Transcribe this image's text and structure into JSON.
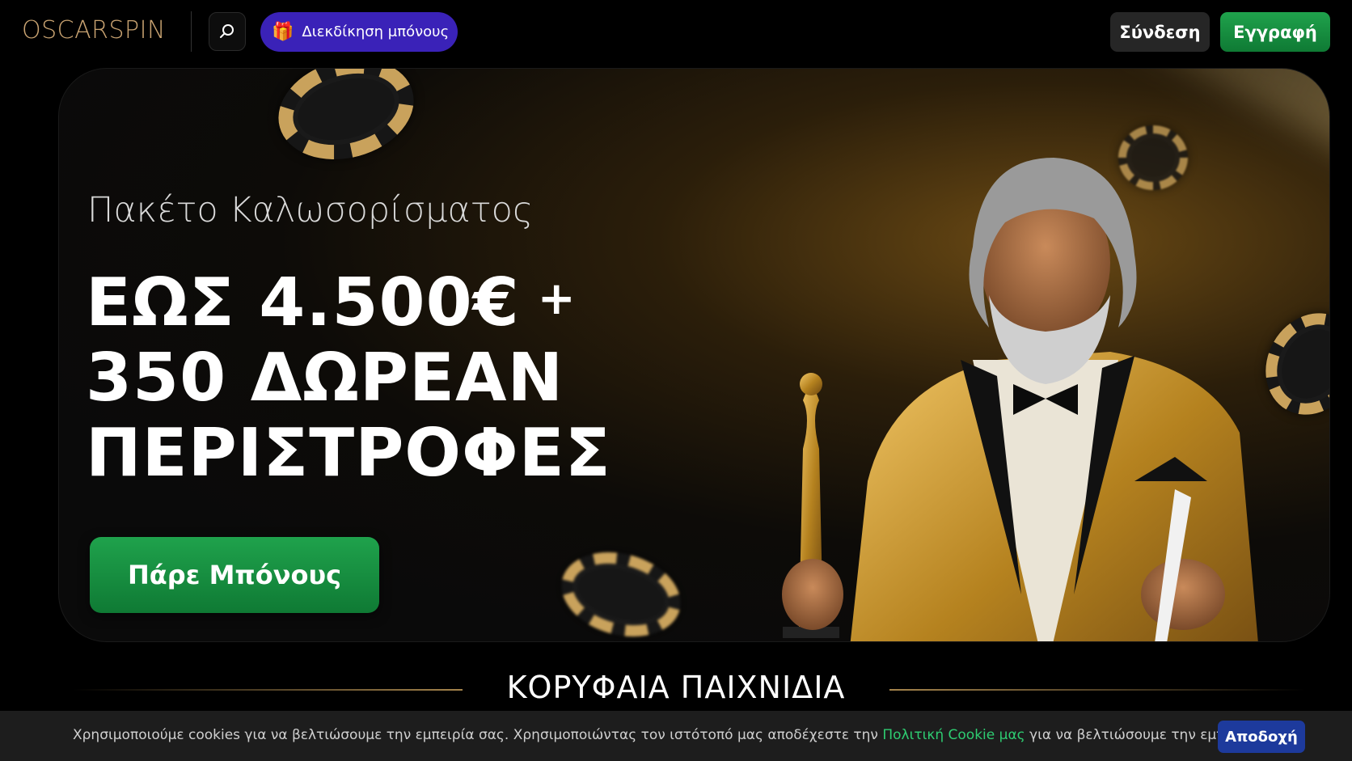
{
  "header": {
    "logo_text": "OSCARSPIN",
    "search_icon": "search-icon",
    "bonus_pill": {
      "icon": "gift-icon",
      "label": "Διεκδίκηση μπόνους"
    },
    "login_label": "Σύνδεση",
    "register_label": "Εγγραφή"
  },
  "hero": {
    "subtitle": "Πακέτο Καλωσορίσματος",
    "headline_line1": "ΕΩΣ 4.500€",
    "headline_plus": "+",
    "headline_line2": "350 ΔΩΡΕΑΝ",
    "headline_line3": "ΠΕΡΙΣΤΡΟΦΕΣ",
    "cta_label": "Πάρε Μπόνους"
  },
  "section": {
    "title": "ΚΟΡΥΦΑΙΑ ΠΑΙΧΝΙΔΙΑ"
  },
  "cookie": {
    "text_before": "Χρησιμοποιούμε cookies για να βελτιώσουμε την εμπειρία σας. Χρησιμοποιώντας τον ιστότοπό μας αποδέχεστε την ",
    "link_text": "Πολιτική Cookie μας",
    "text_after": " για να βελτιώσουμε την εμπειρία σας.",
    "accept_label": "Αποδοχή"
  },
  "colors": {
    "brand_gold": "#caa472",
    "green_button": "#1fa24c",
    "purple_pill": "#3a22b8",
    "accept_blue": "#1d3a9c",
    "link_green": "#2ecc71"
  }
}
